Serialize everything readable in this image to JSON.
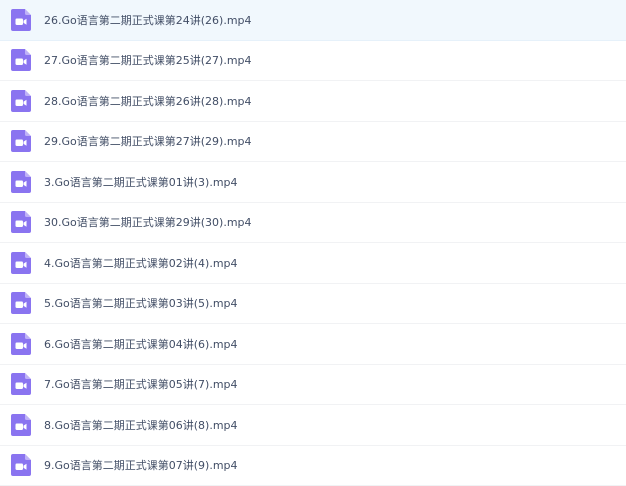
{
  "icon_color": "#8a74f0",
  "files": [
    {
      "name": "26.Go语言第二期正式课第24讲(26).mp4",
      "icon": "video-file-icon"
    },
    {
      "name": "27.Go语言第二期正式课第25讲(27).mp4",
      "icon": "video-file-icon"
    },
    {
      "name": "28.Go语言第二期正式课第26讲(28).mp4",
      "icon": "video-file-icon"
    },
    {
      "name": "29.Go语言第二期正式课第27讲(29).mp4",
      "icon": "video-file-icon"
    },
    {
      "name": "3.Go语言第二期正式课第01讲(3).mp4",
      "icon": "video-file-icon"
    },
    {
      "name": "30.Go语言第二期正式课第29讲(30).mp4",
      "icon": "video-file-icon"
    },
    {
      "name": "4.Go语言第二期正式课第02讲(4).mp4",
      "icon": "video-file-icon"
    },
    {
      "name": "5.Go语言第二期正式课第03讲(5).mp4",
      "icon": "video-file-icon"
    },
    {
      "name": "6.Go语言第二期正式课第04讲(6).mp4",
      "icon": "video-file-icon"
    },
    {
      "name": "7.Go语言第二期正式课第05讲(7).mp4",
      "icon": "video-file-icon"
    },
    {
      "name": "8.Go语言第二期正式课第06讲(8).mp4",
      "icon": "video-file-icon"
    },
    {
      "name": "9.Go语言第二期正式课第07讲(9).mp4",
      "icon": "video-file-icon"
    }
  ]
}
